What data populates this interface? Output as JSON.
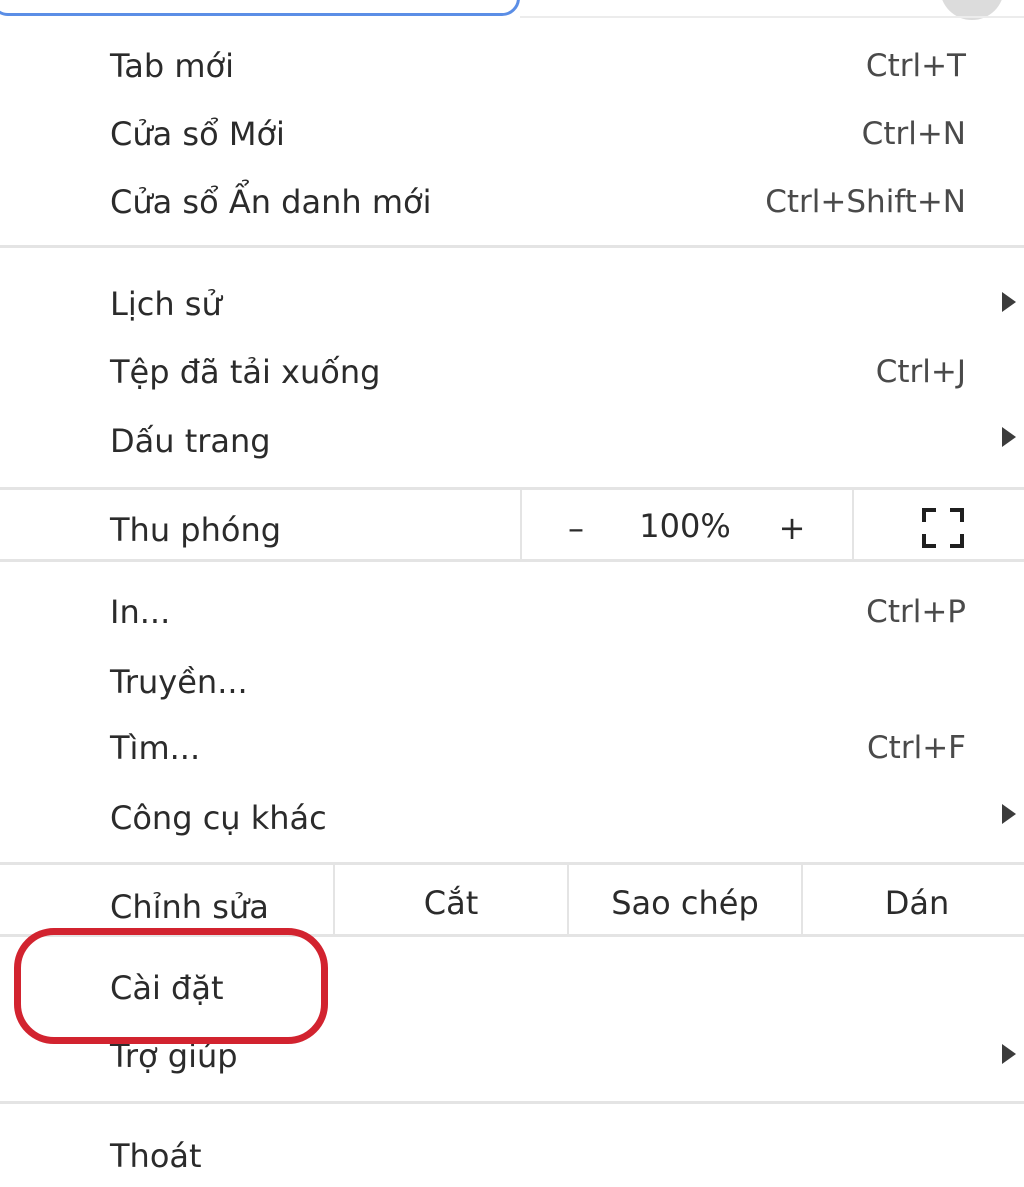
{
  "menu": {
    "new_tab": {
      "label": "Tab mới",
      "shortcut": "Ctrl+T"
    },
    "new_window": {
      "label": "Cửa sổ Mới",
      "shortcut": "Ctrl+N"
    },
    "incognito": {
      "label": "Cửa sổ Ẩn danh mới",
      "shortcut": "Ctrl+Shift+N"
    },
    "history": {
      "label": "Lịch sử"
    },
    "downloads": {
      "label": "Tệp đã tải xuống",
      "shortcut": "Ctrl+J"
    },
    "bookmarks": {
      "label": "Dấu trang"
    },
    "zoom": {
      "label": "Thu phóng",
      "minus": "–",
      "value": "100%",
      "plus": "+"
    },
    "print": {
      "label": "In...",
      "shortcut": "Ctrl+P"
    },
    "cast": {
      "label": "Truyền..."
    },
    "find": {
      "label": "Tìm...",
      "shortcut": "Ctrl+F"
    },
    "more_tools": {
      "label": "Công cụ khác"
    },
    "edit": {
      "label": "Chỉnh sửa",
      "cut": "Cắt",
      "copy": "Sao chép",
      "paste": "Dán"
    },
    "settings": {
      "label": "Cài đặt"
    },
    "help": {
      "label": "Trợ giúp"
    },
    "exit": {
      "label": "Thoát"
    }
  },
  "icons": {
    "fullscreen": "fullscreen-icon",
    "submenu": "chevron-right-icon"
  },
  "colors": {
    "highlight_ring": "#d2232f",
    "omnibox_border": "#5b8ee6"
  }
}
